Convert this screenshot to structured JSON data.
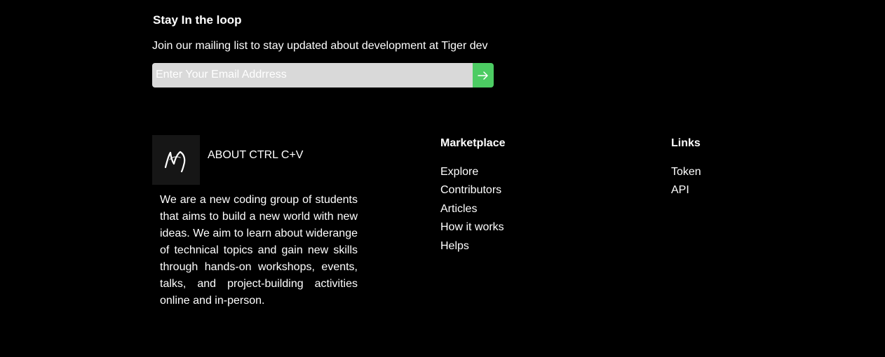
{
  "newsletter": {
    "title": "Stay In the loop",
    "description": "Join our mailing list to stay updated about development at Tiger dev",
    "email_placeholder": "Enter Your Email Addrress",
    "submit_icon": "arrow-right-icon",
    "accent_color": "#4ccc63"
  },
  "about": {
    "logo_icon": "ctrl-cv-logo",
    "title": "ABOUT CTRL C+V",
    "text": "We are a new coding group of students that aims to build a new world with new ideas. We aim to learn about widerange of technical topics and gain new skills through hands-on workshops, events, talks, and project-building activities online and in-person."
  },
  "marketplace": {
    "heading": "Marketplace",
    "links": [
      "Explore",
      "Contributors",
      "Articles",
      "How it works",
      "Helps"
    ]
  },
  "links": {
    "heading": "Links",
    "links": [
      "Token",
      "API"
    ]
  }
}
